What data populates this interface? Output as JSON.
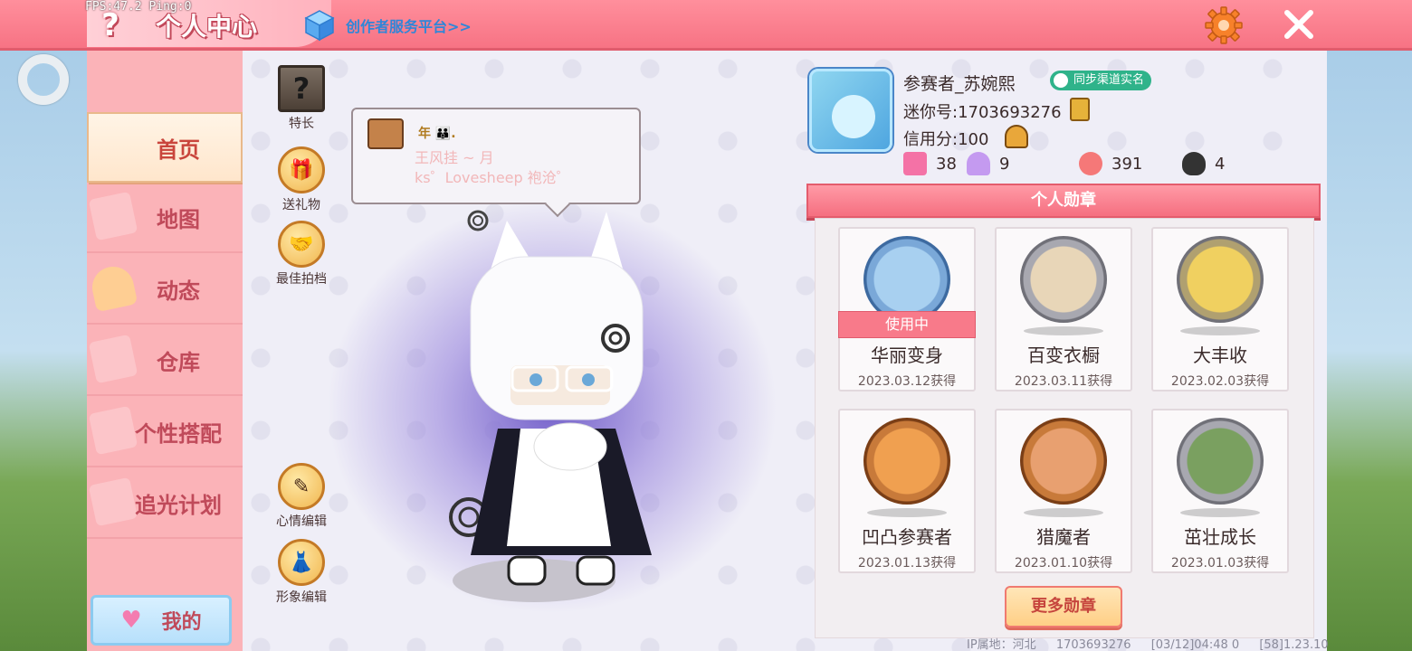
{
  "debug": {
    "fps_text": "FPS:47.2  Ping:0"
  },
  "header": {
    "help_icon": "?",
    "title": "个人中心",
    "creator_link": "创作者服务平台>>",
    "settings_icon": "gear-icon",
    "close_icon": "close-icon"
  },
  "sidebar": {
    "items": [
      {
        "label": "首页",
        "active": true
      },
      {
        "label": "地图",
        "active": false
      },
      {
        "label": "动态",
        "active": false
      },
      {
        "label": "仓库",
        "active": false
      },
      {
        "label": "个性搭配",
        "active": false
      },
      {
        "label": "追光计划",
        "active": false
      }
    ],
    "my_button": "我的"
  },
  "tools": {
    "specialty": "特长",
    "send_gift": "送礼物",
    "best_partner": "最佳拍档",
    "mood_edit": "心情编辑",
    "image_edit": "形象编辑"
  },
  "speech": {
    "badge": "年 👪.",
    "line1": "王风挂 ~ 月",
    "line2": "ks゜Lovesheep 袍沧゜"
  },
  "profile": {
    "name": "参赛者_苏婉熙",
    "sync_badge": "同步渠道实名",
    "mini_id": "迷你号:1703693276",
    "credit": "信用分:100",
    "stats": [
      {
        "icon": "pink-star-card-icon",
        "value": "38",
        "color": "#f472a6"
      },
      {
        "icon": "trophy-icon",
        "value": "9",
        "color": "#b080e8"
      },
      {
        "icon": "fire-icon",
        "value": "391",
        "color": "#f57878"
      },
      {
        "icon": "heart-icon",
        "value": "4",
        "color": "#333333"
      }
    ]
  },
  "medals": {
    "header": "个人勋章",
    "in_use_label": "使用中",
    "items": [
      {
        "name": "华丽变身",
        "date": "2023.03.12获得",
        "in_use": true,
        "ring": "#7aa8d8",
        "core": "#a8d0f0"
      },
      {
        "name": "百变衣橱",
        "date": "2023.03.11获得",
        "in_use": false,
        "ring": "#a8a8b0",
        "core": "#e8d6b8"
      },
      {
        "name": "大丰收",
        "date": "2023.02.03获得",
        "in_use": false,
        "ring": "#b0a070",
        "core": "#f0d060"
      },
      {
        "name": "凹凸参赛者",
        "date": "2023.01.13获得",
        "in_use": false,
        "ring": "#c87a3a",
        "core": "#f0a050"
      },
      {
        "name": "猎魔者",
        "date": "2023.01.10获得",
        "in_use": false,
        "ring": "#c87a3a",
        "core": "#e8a070"
      },
      {
        "name": "茁壮成长",
        "date": "2023.01.03获得",
        "in_use": false,
        "ring": "#a8a8b0",
        "core": "#7aa060"
      }
    ],
    "more_button": "更多勋章"
  },
  "footer": {
    "ip": "IP属地：河北",
    "uid": "1703693276",
    "time": "[03/12]04:48 0",
    "version": "[58]1.23.10"
  }
}
